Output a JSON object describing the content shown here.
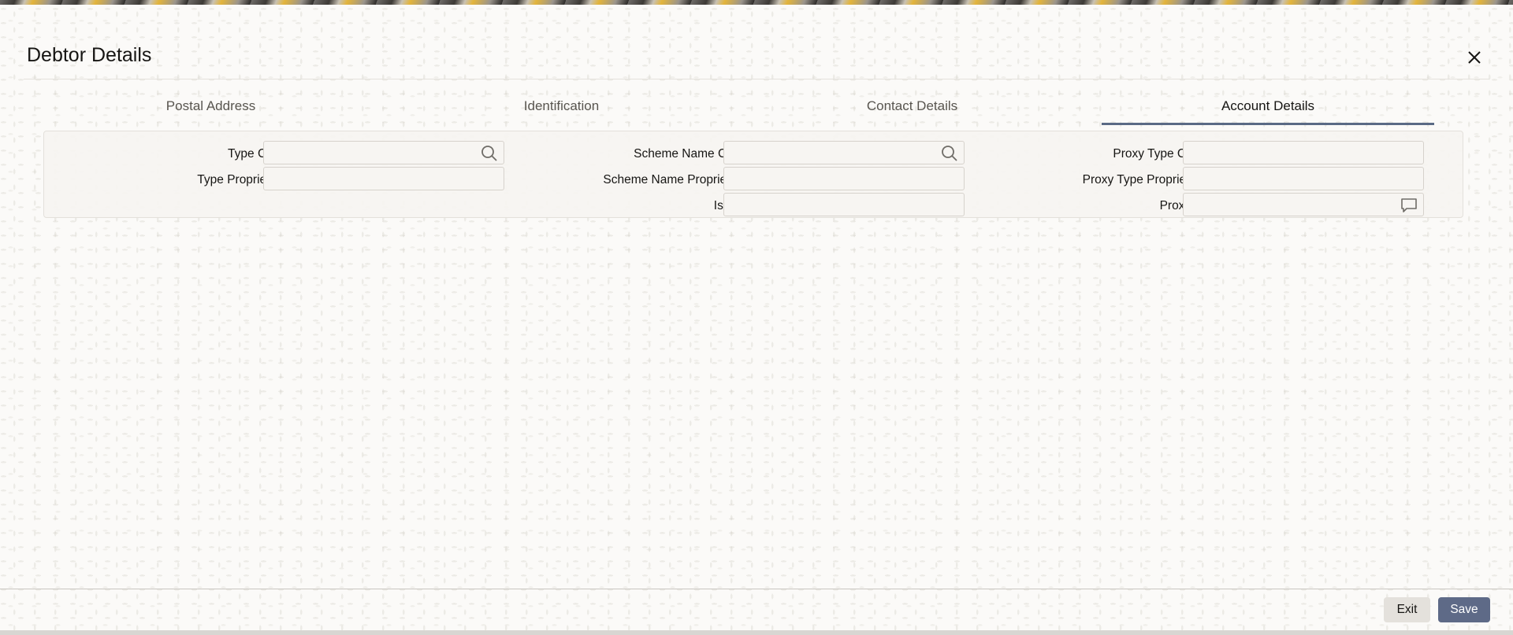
{
  "dialog": {
    "title": "Debtor Details"
  },
  "tabs": [
    {
      "label": "Postal Address",
      "active": false
    },
    {
      "label": "Identification",
      "active": false
    },
    {
      "label": "Contact Details",
      "active": false
    },
    {
      "label": "Account Details",
      "active": true
    }
  ],
  "form": {
    "type_code": {
      "label": "Type Code",
      "value": ""
    },
    "type_proprietary": {
      "label": "Type Proprietary",
      "value": ""
    },
    "scheme_name_code": {
      "label": "Scheme Name Code",
      "value": ""
    },
    "scheme_name_proprietary": {
      "label": "Scheme Name Proprietary",
      "value": ""
    },
    "issuer": {
      "label": "Issuer",
      "value": ""
    },
    "proxy_type_code": {
      "label": "Proxy Type Code",
      "value": ""
    },
    "proxy_type_proprietary": {
      "label": "Proxy Type Proprietary",
      "value": ""
    },
    "proxy_id": {
      "label": "Proxy ID",
      "value": ""
    }
  },
  "footer": {
    "exit_label": "Exit",
    "save_label": "Save"
  },
  "icons": {
    "close": "close-icon",
    "lookup": "search-icon",
    "narrative": "speech-bubble-icon"
  },
  "colors": {
    "accent": "#5e6a87",
    "active_tab_underline": "#5a6a85"
  }
}
